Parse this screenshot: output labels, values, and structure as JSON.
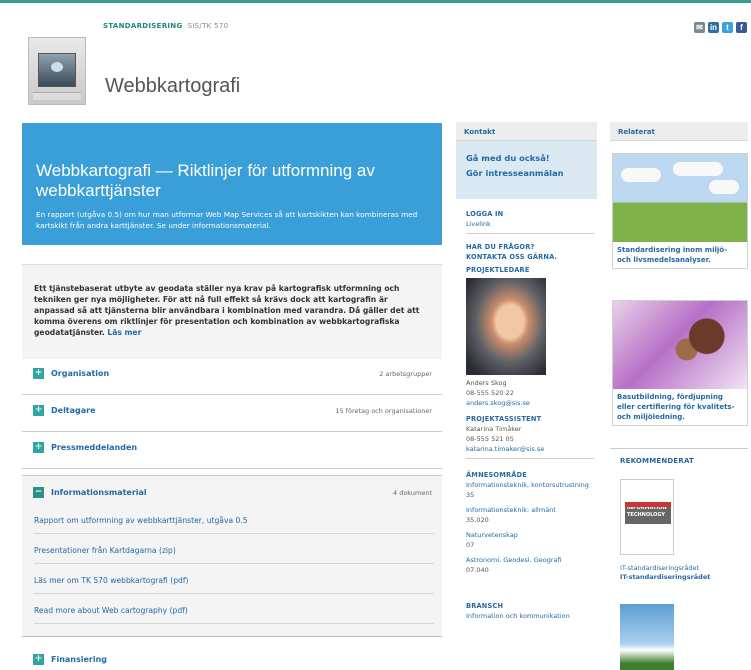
{
  "breadcrumb": {
    "section": "STANDARDISERING",
    "sub": "SIS/TK 570"
  },
  "page_title": "Webbkartografi",
  "share": [
    "✉",
    "in",
    "t",
    "f"
  ],
  "hero": {
    "title": "Webbkartografi — Riktlinjer för utformning av webbkarttjänster",
    "text": "En rapport (utgåva 0.5) om hur man utformar Web Map Services så att kartskikten kan kombineras med kartskikt från andra karttjänster. Se under informationsmaterial."
  },
  "intro": {
    "text": "Ett tjänstebaserat utbyte av geodata ställer nya krav på kartografisk utformning och tekniken ger nya möjligheter. För att nå full effekt så krävs dock att kartografin är anpassad så att tjänsterna blir användbara i kombination med varandra. Då gäller det att komma överens om riktlinjer för presentation och kombination av webbkartografiska geodatatjänster.",
    "more": "Läs mer"
  },
  "accordion": [
    {
      "label": "Organisation",
      "count": "2 arbetsgrupper",
      "icon": "+"
    },
    {
      "label": "Deltagare",
      "count": "15 företag och organisationer",
      "icon": "+"
    },
    {
      "label": "Pressmeddelanden",
      "count": "",
      "icon": "+"
    },
    {
      "label": "Informationsmaterial",
      "count": "4 dokument",
      "icon": "−"
    }
  ],
  "documents": [
    "Rapport om utformning av webbkarttjänster, utgåva 0.5",
    "Presentationer från Kartdagarna (zip)",
    "Läs mer om TK 570 webbkartografi (pdf)",
    "Read more about Web cartography (pdf)"
  ],
  "finansiering": {
    "label": "Finansiering",
    "icon": "+"
  },
  "kontakt": {
    "header": "Kontakt",
    "join1": "Gå med du också!",
    "join2": "Gör intresseanmälan",
    "login_title": "LOGGA IN",
    "login_sub": "Livelink",
    "questions": "HAR DU FRÅGOR?",
    "contact_us": "KONTAKTA OSS GÄRNA.",
    "pl_title": "PROJEKTLEDARE",
    "pl_name": "Anders Skog",
    "pl_phone": "08-555 520 22",
    "pl_email": "anders.skog@sis.se",
    "pa_title": "PROJEKTASSISTENT",
    "pa_name": "Katarina Timåker",
    "pa_phone": "08-555 521 05",
    "pa_email": "katarina.timaker@sis.se",
    "area_title": "ÄMNESOMRÅDE",
    "areas": [
      {
        "name": "Informationsteknik, kontorsutrustning",
        "code": "35"
      },
      {
        "name": "Informationsteknik: allmänt",
        "code": "35.020"
      },
      {
        "name": "Naturvetenskap",
        "code": "07"
      },
      {
        "name": "Astronomi. Geodesi. Geografi",
        "code": "07.040"
      }
    ],
    "branch_title": "BRANSCH",
    "branch": "Information och kommunikation"
  },
  "relaterat": {
    "header": "Relaterat",
    "card1": "Standardisering inom miljö- och livsmedelsanalyser.",
    "card2": "Basutbildning, fördjupning eller certifiering för kvalitets- och miljöledning.",
    "rec_title": "REKOMMENDERAT",
    "book_cover": "INFORMATION TECHNOLOGY",
    "book_line1": "IT-standardiseringsrådet",
    "book_line2": "IT-standardiseringsrådet"
  },
  "colors": {
    "accent": "#3a9ed8",
    "link": "#2469a4",
    "teal": "#1a8a7a"
  }
}
